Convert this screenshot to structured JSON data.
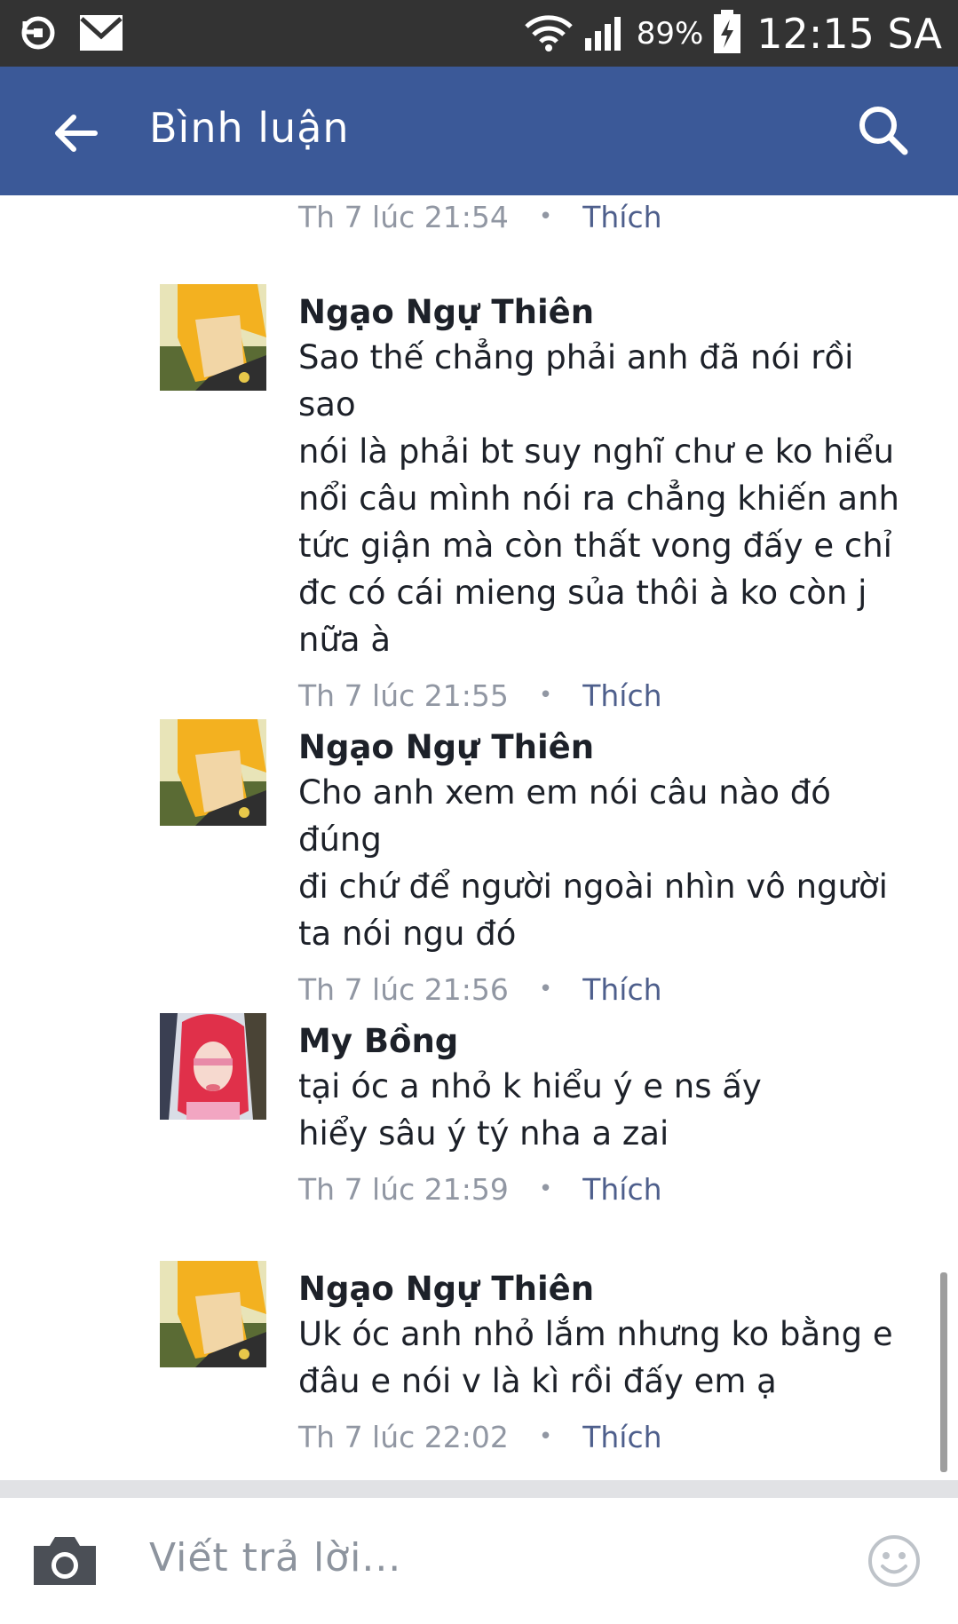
{
  "status_bar": {
    "battery_percent": "89%",
    "time": "12:15 SA",
    "icons": [
      "sync-icon",
      "mail-icon",
      "wifi-icon",
      "signal-icon",
      "battery-charging-icon"
    ]
  },
  "app_bar": {
    "title": "Bình luận",
    "back_icon": "arrow-left-icon",
    "search_icon": "search-icon"
  },
  "colors": {
    "app_bar": "#3b5998",
    "status_bar": "#333333",
    "meta_text": "#9197a3",
    "like_link": "#4e5f8c"
  },
  "top_meta": {
    "time": "Th 7 lúc 21:54",
    "like": "Thích"
  },
  "comments": [
    {
      "name": "Ngạo Ngự Thiên",
      "avatar": "anime-character-avatar",
      "lines": [
        "Sao thế chẳng phải anh đã nói rồi sao",
        "nói là phải bt suy nghĩ chư e ko hiểu",
        "nổi câu mình nói ra chẳng khiến anh",
        "tức giận mà còn thất vong đấy e chỉ",
        "đc có cái mieng sủa thôi à ko còn j",
        "nữa à"
      ],
      "time": "Th 7 lúc 21:55",
      "like": "Thích"
    },
    {
      "name": "Ngạo Ngự Thiên",
      "avatar": "anime-character-avatar",
      "lines": [
        "Cho anh xem em nói câu nào đó đúng",
        "đi chứ để người ngoài nhìn vô người",
        "ta nói ngu đó"
      ],
      "time": "Th 7 lúc 21:56",
      "like": "Thích"
    },
    {
      "name": "My Bồng",
      "avatar": "pink-hair-girl-avatar",
      "lines": [
        "tại óc a nhỏ k hiểu ý e ns ấy",
        "hiểy sâu ý tý nha a zai"
      ],
      "time": "Th 7 lúc 21:59",
      "like": "Thích"
    },
    {
      "name": "Ngạo Ngự Thiên",
      "avatar": "anime-character-avatar",
      "lines": [
        "Uk óc anh nhỏ lắm nhưng ko bằng e",
        "đâu e nói v là kì rồi đấy em ạ"
      ],
      "time": "Th 7 lúc 22:02",
      "like": "Thích"
    }
  ],
  "composer": {
    "placeholder": "Viết trả lời...",
    "camera_icon": "camera-icon",
    "emoji_icon": "smiley-icon"
  }
}
